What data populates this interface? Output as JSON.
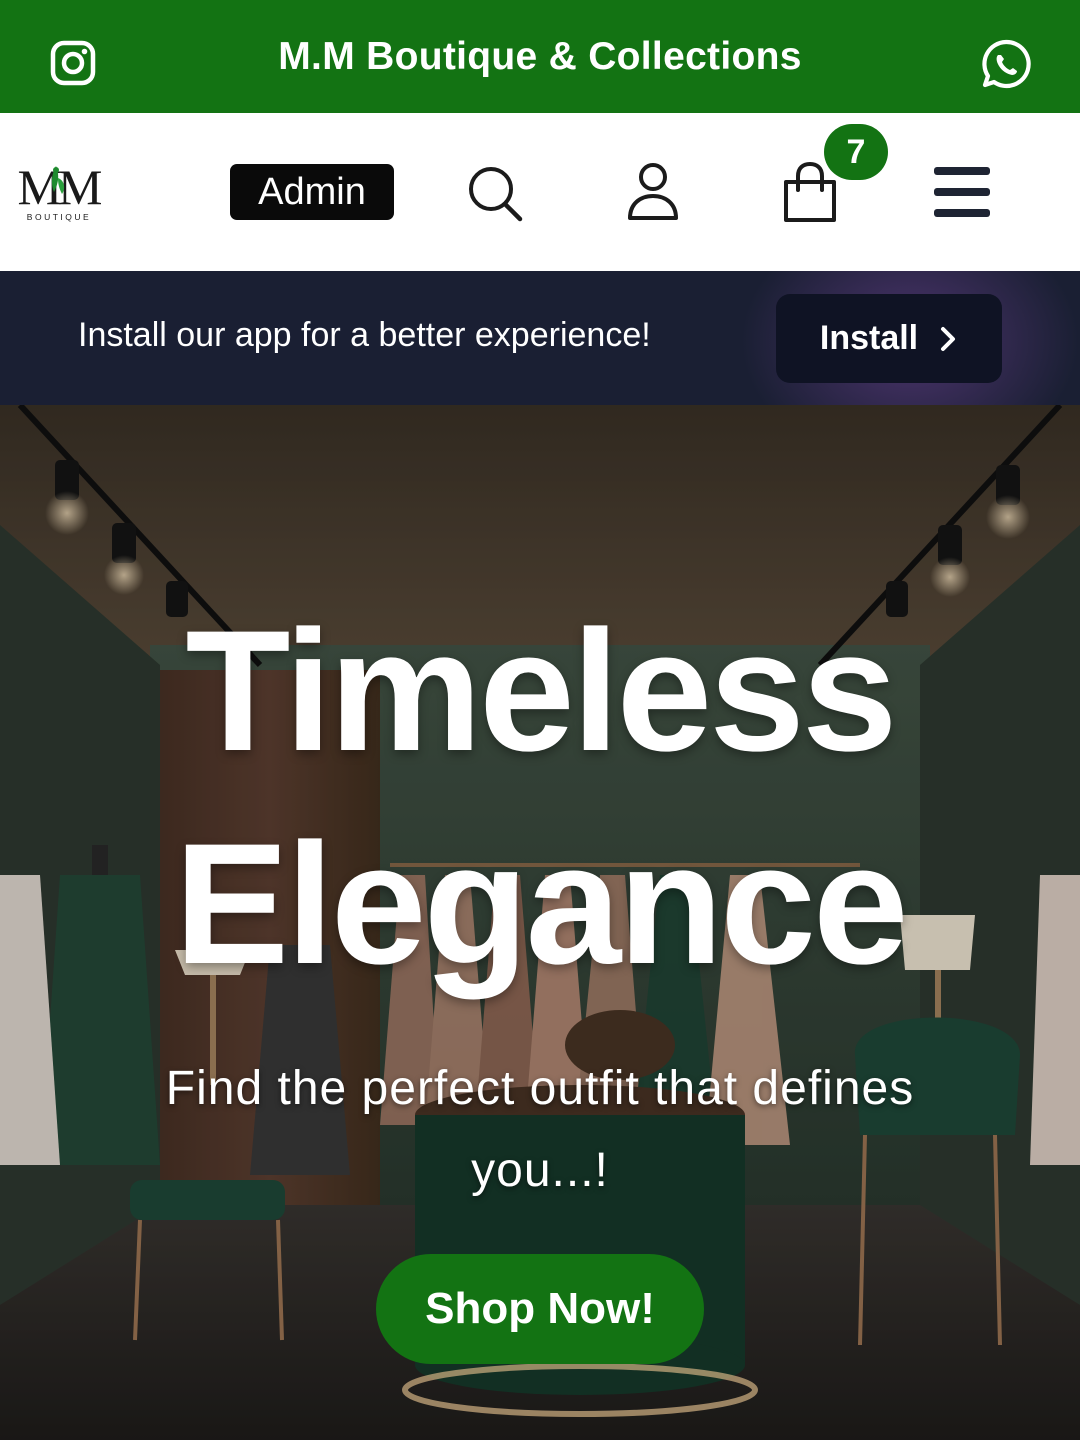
{
  "topbar": {
    "brand": "M.M Boutique & Collections",
    "left_icon": "instagram-icon",
    "right_icon": "whatsapp-icon",
    "color": "#137313"
  },
  "nav": {
    "logo_text": "MM",
    "logo_subtext": "BOUTIQUE",
    "admin_label": "Admin",
    "icons": [
      "search-icon",
      "user-icon",
      "shopping-bag-icon",
      "hamburger-menu-icon"
    ],
    "cart_count": "7"
  },
  "install_banner": {
    "message": "Install our app for a better experience!",
    "button_label": "Install",
    "background": "#1a1f33"
  },
  "hero": {
    "title_line1": "Timeless",
    "title_line2": "Elegance",
    "subtitle": "Find the perfect outfit that defines you...!",
    "cta_label": "Shop Now!",
    "cta_color": "#137313"
  }
}
